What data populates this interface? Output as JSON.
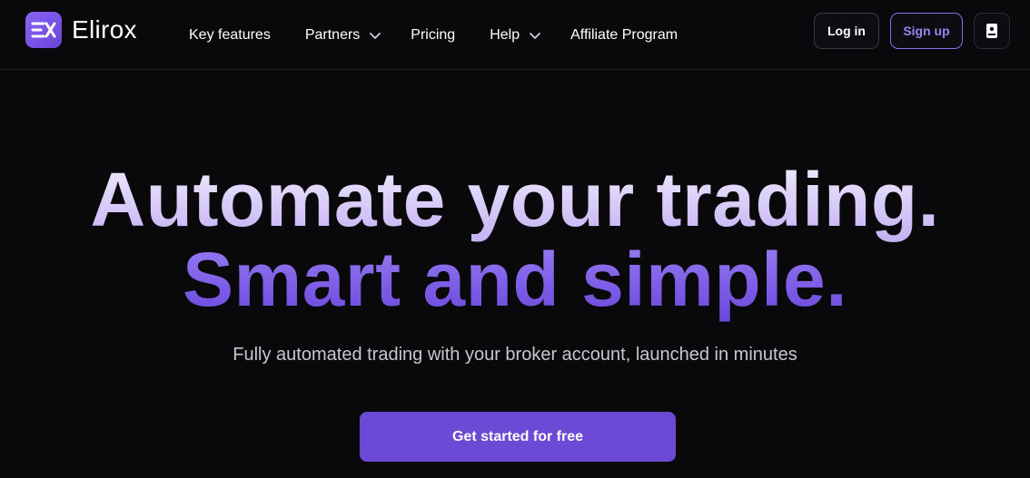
{
  "brand": {
    "name": "Elirox",
    "logo_icon": "elirox-logo-mark",
    "accent_color": "#7b58e3"
  },
  "nav": {
    "items": [
      {
        "label": "Key features",
        "has_dropdown": false
      },
      {
        "label": "Partners",
        "has_dropdown": true
      },
      {
        "label": "Pricing",
        "has_dropdown": false
      },
      {
        "label": "Help",
        "has_dropdown": true
      },
      {
        "label": "Affiliate Program",
        "has_dropdown": false
      }
    ]
  },
  "header_actions": {
    "login_label": "Log in",
    "signup_label": "Sign up",
    "lang_icon": "language-book-icon"
  },
  "hero": {
    "headline_line1": "Automate your trading.",
    "headline_line2": "Smart and simple.",
    "subtitle": "Fully automated trading with your broker account, launched in minutes",
    "cta_label": "Get started for free"
  }
}
